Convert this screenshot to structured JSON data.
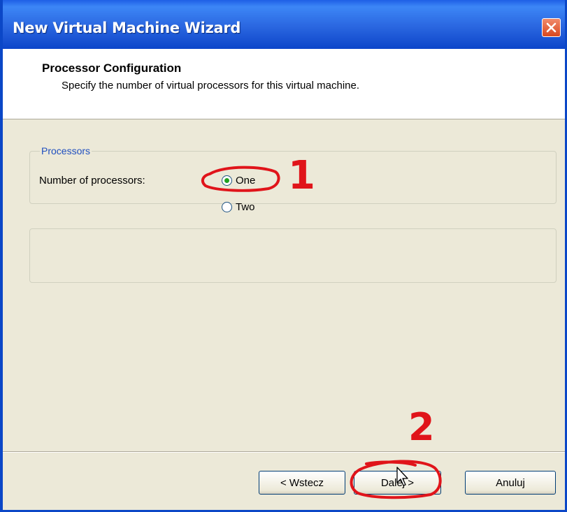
{
  "window": {
    "title": "New Virtual Machine Wizard"
  },
  "header": {
    "title": "Processor Configuration",
    "subtitle": "Specify the number of virtual processors for this virtual machine."
  },
  "processors_group": {
    "legend": "Processors",
    "label": "Number of processors:",
    "options": [
      {
        "label": "One",
        "selected": true
      },
      {
        "label": "Two",
        "selected": false
      }
    ]
  },
  "buttons": {
    "back": "< Wstecz",
    "next": "Dalej >",
    "cancel": "Anuluj"
  },
  "annotations": {
    "step1": "1",
    "step2": "2",
    "color": "#e0141a"
  },
  "colors": {
    "titlebar": "#2a66e0",
    "dialog_bg": "#ece9d8",
    "close_button": "#d9481f",
    "selected_radio": "#21a121"
  },
  "icons": {
    "close": "close-icon",
    "cursor": "mouse-pointer-icon"
  }
}
